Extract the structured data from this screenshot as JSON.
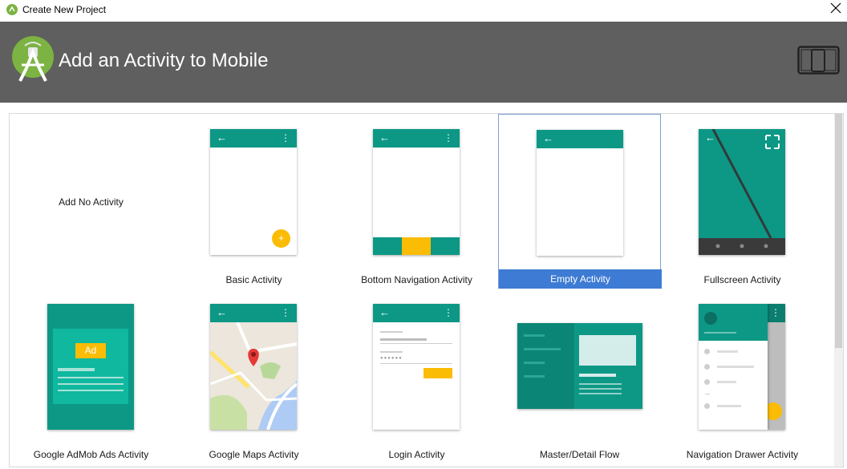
{
  "window": {
    "title": "Create New Project"
  },
  "header": {
    "title": "Add an Activity to Mobile"
  },
  "colors": {
    "header_bg": "#5f5f5f",
    "teal": "#0d9886",
    "accent_yellow": "#fbbc05",
    "selection": "#3e7bd4"
  },
  "icons": {
    "app": "android-studio-icon",
    "close": "close-icon",
    "logo": "android-studio-logo",
    "device": "phone-tablet-icon"
  },
  "templates": [
    {
      "label": "Add No Activity",
      "selected": false
    },
    {
      "label": "Basic Activity",
      "selected": false
    },
    {
      "label": "Bottom Navigation Activity",
      "selected": false
    },
    {
      "label": "Empty Activity",
      "selected": true
    },
    {
      "label": "Fullscreen Activity",
      "selected": false
    },
    {
      "label": "Google AdMob Ads Activity",
      "selected": false,
      "badge": "Ad"
    },
    {
      "label": "Google Maps Activity",
      "selected": false
    },
    {
      "label": "Login Activity",
      "selected": false
    },
    {
      "label": "Master/Detail Flow",
      "selected": false
    },
    {
      "label": "Navigation Drawer Activity",
      "selected": false
    }
  ]
}
